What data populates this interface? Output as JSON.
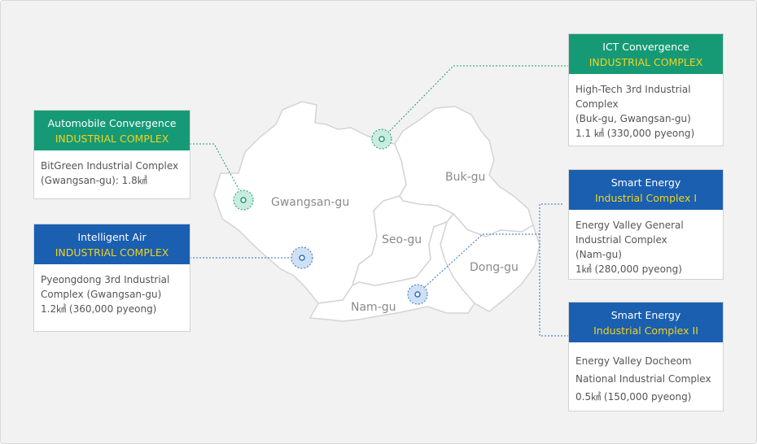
{
  "map": {
    "districts": [
      {
        "id": "gwangsan",
        "label": "Gwangsan-gu"
      },
      {
        "id": "buk",
        "label": "Buk-gu"
      },
      {
        "id": "seo",
        "label": "Seo-gu"
      },
      {
        "id": "dong",
        "label": "Dong-gu"
      },
      {
        "id": "nam",
        "label": "Nam-gu"
      }
    ]
  },
  "complexes": {
    "automobile": {
      "title": "Automobile Convergence",
      "subtitle": "INDUSTRIAL COMPLEX",
      "lines": [
        "BitGreen Industrial Complex",
        "(Gwangsan-gu): 1.8㎢"
      ]
    },
    "air": {
      "title": "Intelligent Air",
      "subtitle": "INDUSTRIAL COMPLEX",
      "lines": [
        "Pyeongdong 3rd Industrial",
        "Complex (Gwangsan-gu)",
        "1.2㎢ (360,000 pyeong)"
      ]
    },
    "ict": {
      "title": "ICT Convergence",
      "subtitle": "INDUSTRIAL COMPLEX",
      "lines": [
        "High-Tech 3rd Industrial",
        "Complex",
        "(Buk-gu, Gwangsan-gu)",
        "1.1 ㎢ (330,000 pyeong)"
      ]
    },
    "energy1": {
      "title": "Smart Energy",
      "subtitle": "Industrial Complex I",
      "lines": [
        "Energy Valley General",
        "Industrial Complex",
        "(Nam-gu)",
        "1㎢ (280,000 pyeong)"
      ]
    },
    "energy2": {
      "title": "Smart Energy",
      "subtitle": "Industrial Complex II",
      "lines": [
        "Energy Valley Docheom",
        "National Industrial Complex",
        "0.5㎢ (150,000 pyeong)"
      ]
    }
  },
  "colors": {
    "green_header": "#169a76",
    "blue_header": "#1a5fb0",
    "subtitle": "#f2d21f",
    "marker_green": "#169a76",
    "marker_blue": "#2a6fc4"
  }
}
